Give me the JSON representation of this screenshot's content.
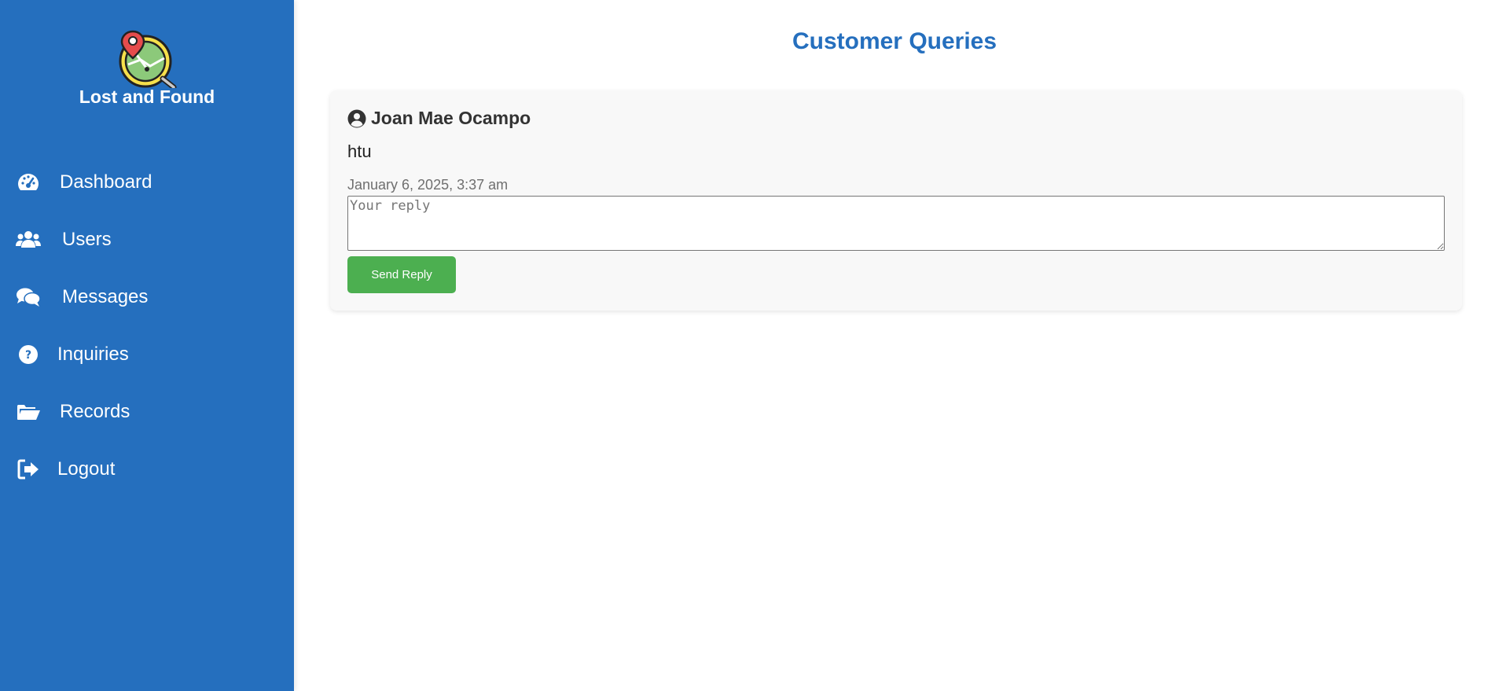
{
  "app": {
    "title": "Lost and Found"
  },
  "sidebar": {
    "items": [
      {
        "label": "Dashboard",
        "icon": "dashboard-gauge-icon"
      },
      {
        "label": "Users",
        "icon": "users-icon"
      },
      {
        "label": "Messages",
        "icon": "comments-icon"
      },
      {
        "label": "Inquiries",
        "icon": "question-circle-icon"
      },
      {
        "label": "Records",
        "icon": "folder-open-icon"
      },
      {
        "label": "Logout",
        "icon": "logout-icon"
      }
    ]
  },
  "main": {
    "title": "Customer Queries",
    "queries": [
      {
        "name": "Joan Mae Ocampo",
        "message": "htu",
        "timestamp": "January 6, 2025, 3:37 am",
        "reply_placeholder": "Your reply",
        "reply_value": "",
        "send_label": "Send Reply"
      }
    ]
  },
  "colors": {
    "sidebar": "#256fbe",
    "accent": "#256fbe",
    "send_button": "#4caf50",
    "card_background": "#f8f8f8"
  }
}
